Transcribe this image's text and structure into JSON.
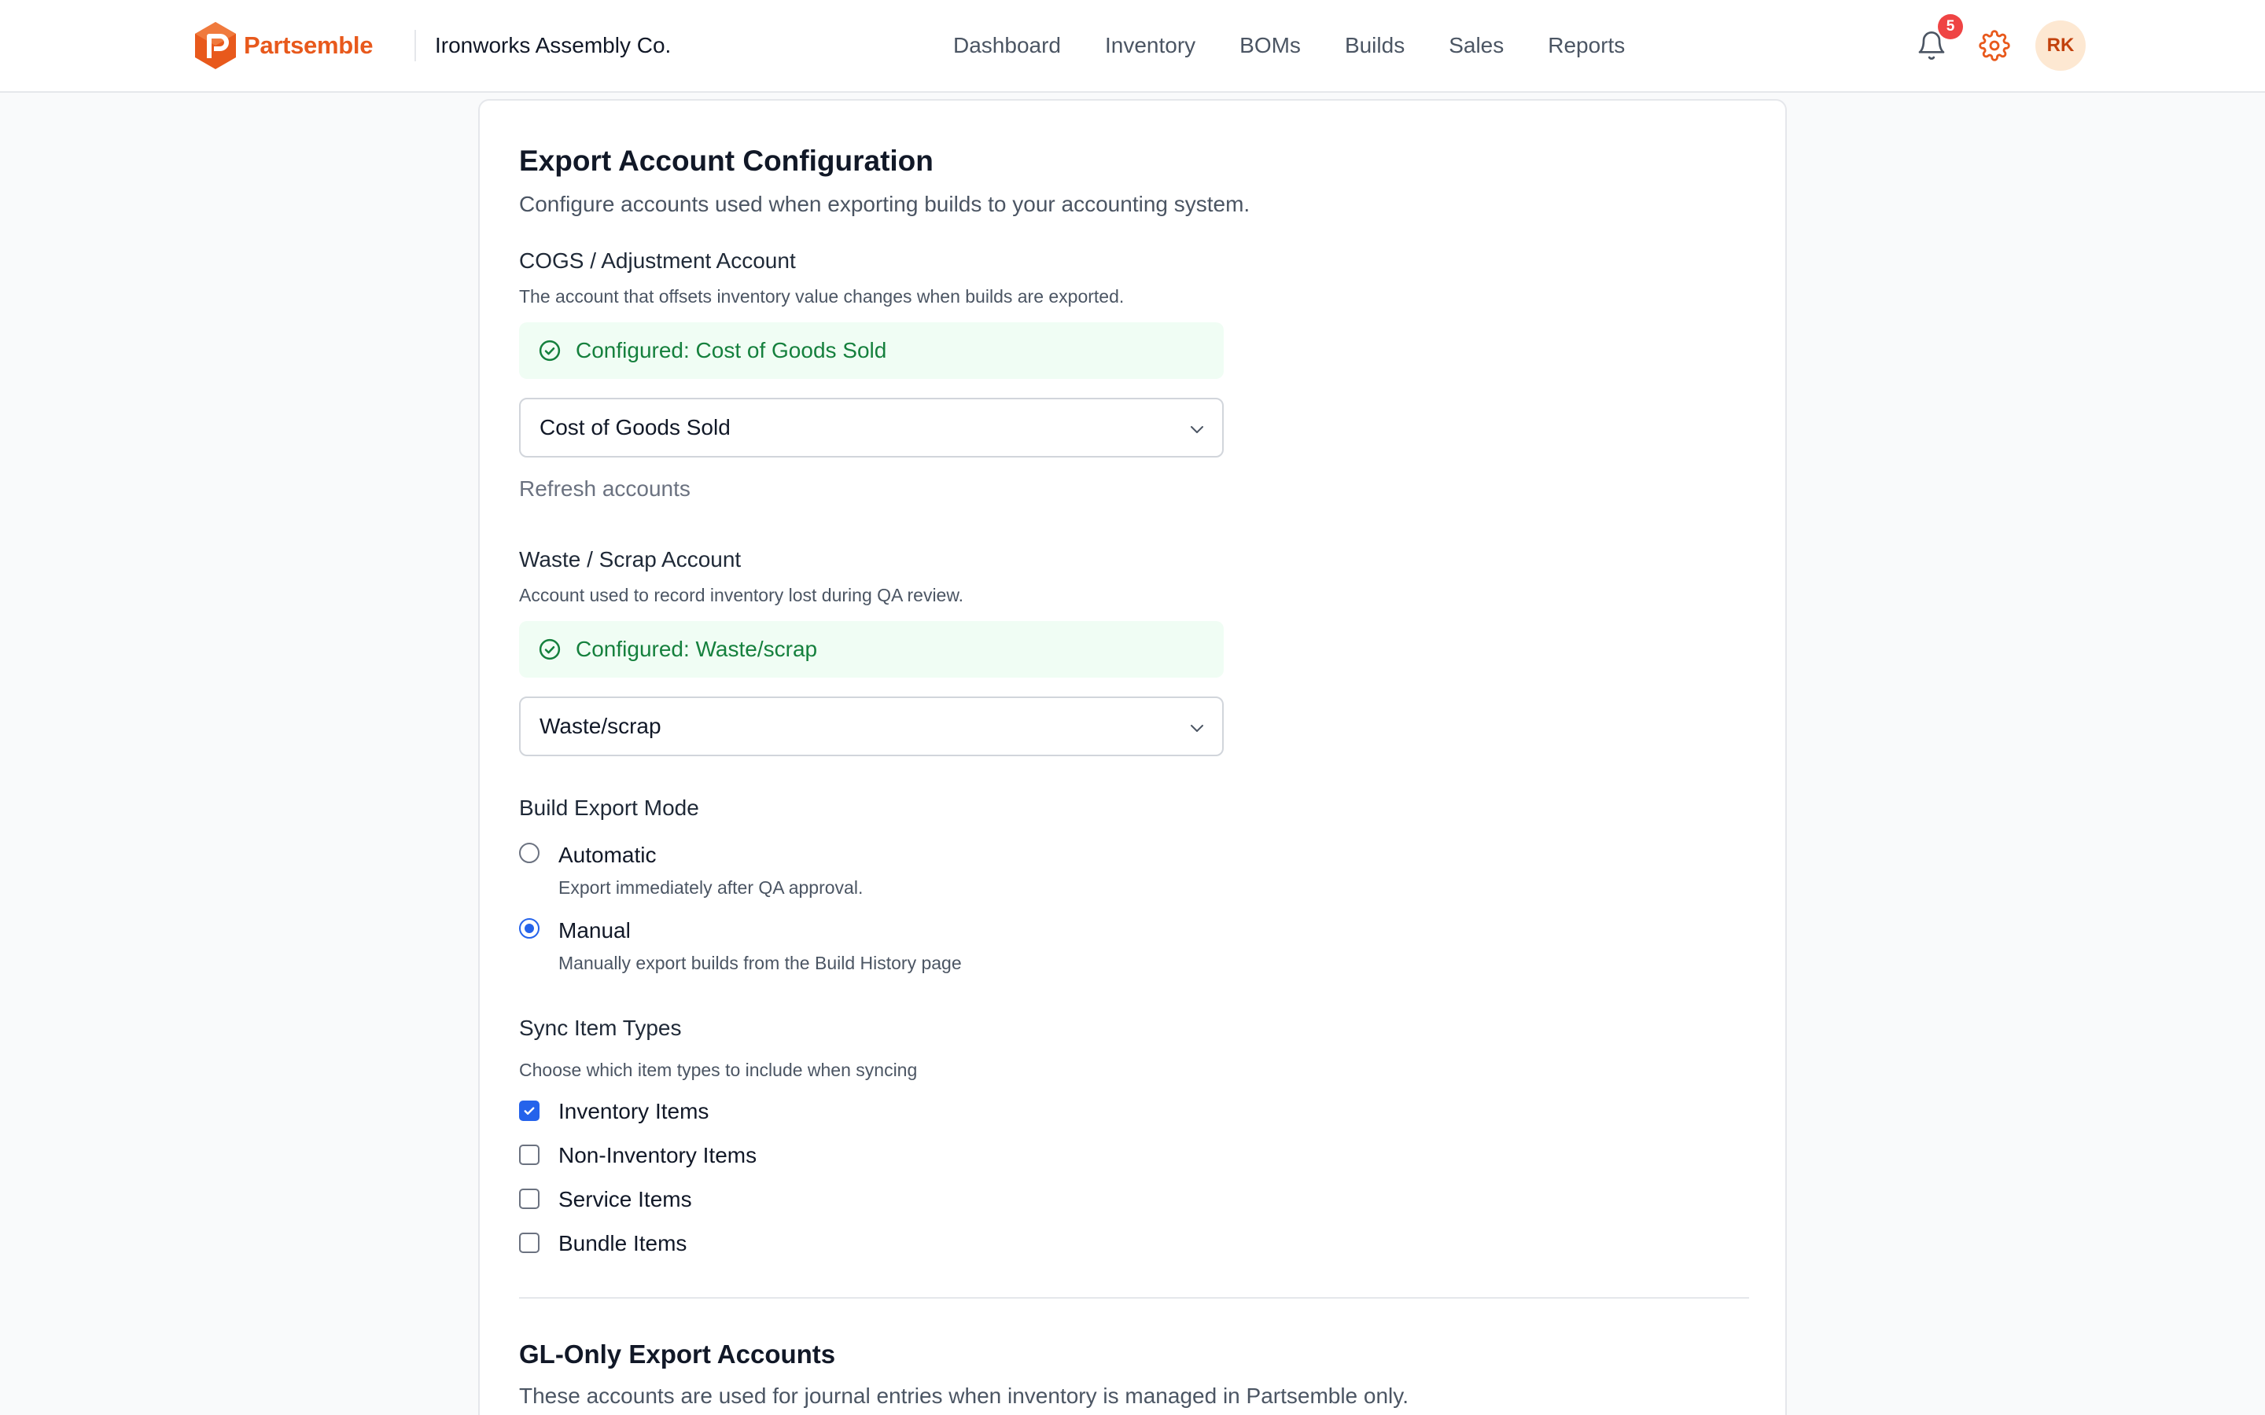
{
  "header": {
    "brand_name": "Partsemble",
    "org_name": "Ironworks Assembly Co.",
    "nav": [
      {
        "label": "Dashboard"
      },
      {
        "label": "Inventory"
      },
      {
        "label": "BOMs"
      },
      {
        "label": "Builds"
      },
      {
        "label": "Sales"
      },
      {
        "label": "Reports"
      }
    ],
    "notification_count": "5",
    "avatar_initials": "RK",
    "icons": {
      "notifications": "bell-icon",
      "settings": "gear-icon"
    }
  },
  "page": {
    "title": "Export Account Configuration",
    "subtitle": "Configure accounts used when exporting builds to your accounting system."
  },
  "cogs": {
    "label": "COGS / Adjustment Account",
    "help": "The account that offsets inventory value changes when builds are exported.",
    "status": "Configured: Cost of Goods Sold",
    "selected": "Cost of Goods Sold",
    "refresh_label": "Refresh accounts"
  },
  "waste": {
    "label": "Waste / Scrap Account",
    "help": "Account used to record inventory lost during QA review.",
    "status": "Configured: Waste/scrap",
    "selected": "Waste/scrap"
  },
  "export_mode": {
    "label": "Build Export Mode",
    "options": [
      {
        "label": "Automatic",
        "description": "Export immediately after QA approval.",
        "selected": false
      },
      {
        "label": "Manual",
        "description": "Manually export builds from the Build History page",
        "selected": true
      }
    ]
  },
  "sync_types": {
    "label": "Sync Item Types",
    "help": "Choose which item types to include when syncing",
    "options": [
      {
        "label": "Inventory Items",
        "checked": true
      },
      {
        "label": "Non-Inventory Items",
        "checked": false
      },
      {
        "label": "Service Items",
        "checked": false
      },
      {
        "label": "Bundle Items",
        "checked": false
      }
    ]
  },
  "gl_section": {
    "title": "GL-Only Export Accounts",
    "subtitle": "These accounts are used for journal entries when inventory is managed in Partsemble only."
  },
  "colors": {
    "brand": "#e8591c",
    "accent": "#2563eb",
    "success_bg": "#f0fdf4",
    "success_text": "#15803d",
    "badge": "#ef4444"
  }
}
